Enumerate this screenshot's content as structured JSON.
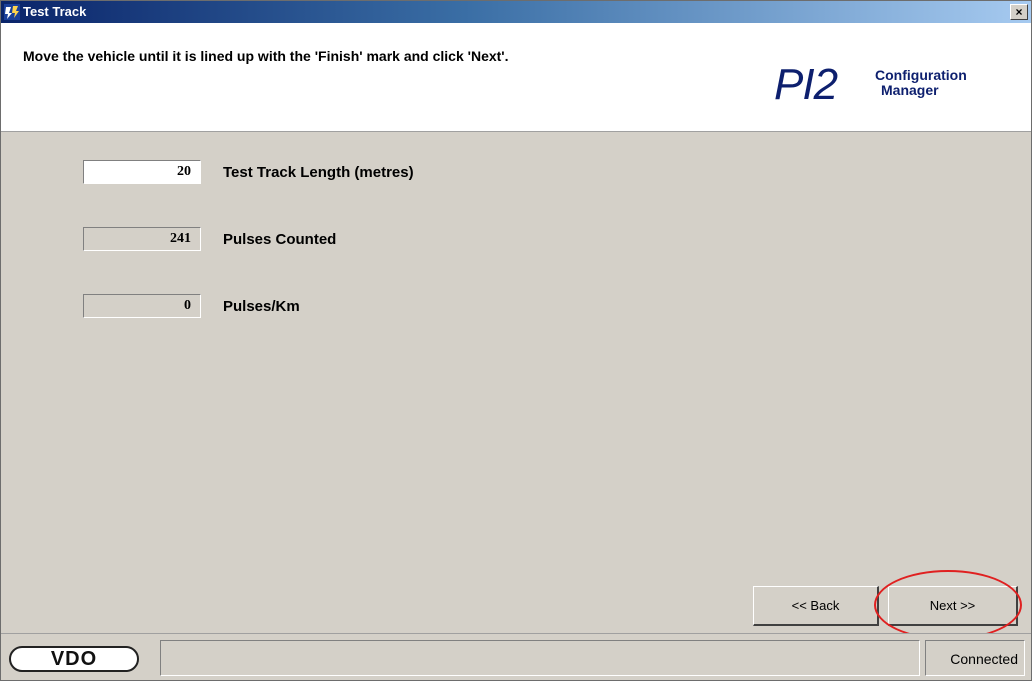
{
  "window": {
    "title": "Test Track",
    "close_label": "×"
  },
  "header": {
    "instruction": "Move the vehicle until it is lined up with the 'Finish' mark and click 'Next'.",
    "logo_main": "PI2",
    "logo_line1": "Configuration",
    "logo_line2": "Manager"
  },
  "fields": [
    {
      "value": "20",
      "label": "Test Track Length (metres)",
      "editable": true
    },
    {
      "value": "241",
      "label": "Pulses Counted",
      "editable": false
    },
    {
      "value": "0",
      "label": "Pulses/Km",
      "editable": false
    }
  ],
  "buttons": {
    "back": "<< Back",
    "next": "Next >>"
  },
  "statusbar": {
    "brand": "VDO",
    "status": "Connected"
  },
  "colors": {
    "titlebar_start": "#0a246a",
    "titlebar_end": "#a6caf0",
    "logo": "#0d1f6e",
    "dialog_bg": "#d4d0c8",
    "highlight": "#e02020"
  }
}
